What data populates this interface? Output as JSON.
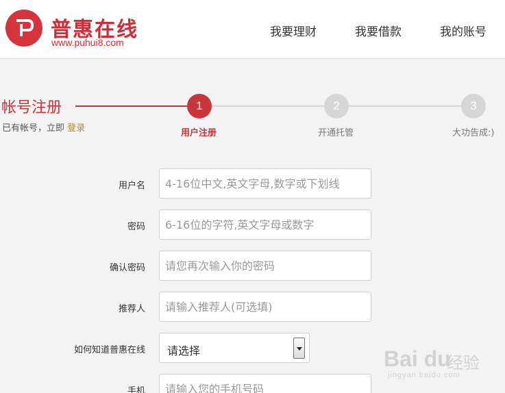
{
  "header": {
    "logo_title": "普惠在线",
    "logo_url": "www.puhui8.com",
    "nav": [
      "我要理财",
      "我要借款",
      "我的账号"
    ]
  },
  "register": {
    "title": "帐号注册",
    "has_account_text": "已有帐号，立即",
    "login_link": "登录"
  },
  "steps": [
    {
      "number": "1",
      "label": "用户注册",
      "active": true
    },
    {
      "number": "2",
      "label": "开通托管",
      "active": false
    },
    {
      "number": "3",
      "label": "大功告成:)",
      "active": false
    }
  ],
  "form": {
    "username": {
      "label": "用户名",
      "placeholder": "4-16位中文,英文字母,数字或下划线"
    },
    "password": {
      "label": "密码",
      "placeholder": "6-16位的字符,英文字母或数字"
    },
    "confirm_password": {
      "label": "确认密码",
      "placeholder": "请您再次输入你的密码"
    },
    "referrer": {
      "label": "推荐人",
      "placeholder": "请输入推荐人(可选填)"
    },
    "source": {
      "label": "如何知道普惠在线",
      "selected": "请选择"
    },
    "phone": {
      "label": "手机",
      "placeholder": "请输入您的手机号码"
    }
  },
  "watermark": {
    "brand": "Bai du",
    "cn": "经验",
    "url": "jingyan.baidu.com"
  },
  "colors": {
    "brand_red": "#d12c36",
    "accent": "#c6363a",
    "link": "#c28421",
    "step_inactive": "#d6d6d6"
  }
}
